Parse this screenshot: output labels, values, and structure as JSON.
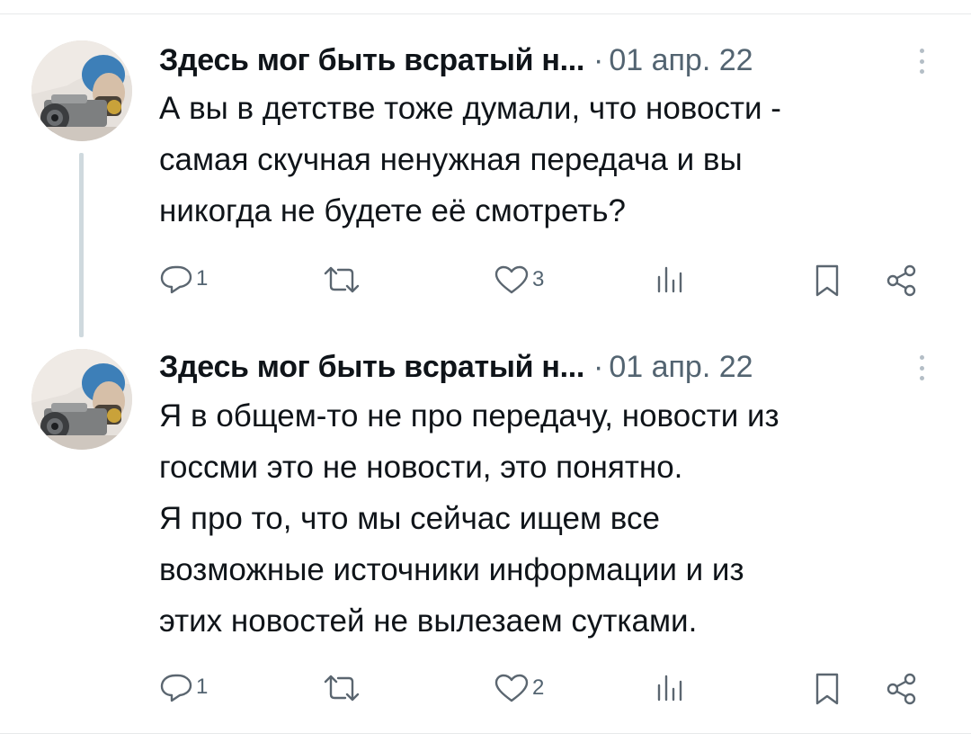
{
  "tweets": [
    {
      "author": "Здесь мог быть вcратый н...",
      "separator": "·",
      "date": "01 апр. 22",
      "lines": [
        "А вы в детстве тоже думали, что новости -",
        "самая скучная ненужная передача и вы",
        "никогда не будете её смотреть?"
      ],
      "actions": {
        "replies": "1",
        "retweets": "",
        "likes": "3"
      },
      "icons": [
        "avatar-image",
        "more-icon",
        "reply-icon",
        "retweet-icon",
        "like-icon",
        "views-icon",
        "bookmark-icon",
        "share-icon"
      ]
    },
    {
      "author": "Здесь мог быть вcратый н...",
      "separator": "·",
      "date": "01 апр. 22",
      "lines": [
        "Я в общем-то не про передачу, новости из",
        "госсми это не новости, это понятно.",
        "Я про то, что мы сейчас ищем все",
        "возможные источники информации и из",
        "этих новостей не вылезаем сутками."
      ],
      "actions": {
        "replies": "1",
        "retweets": "",
        "likes": "2"
      },
      "icons": [
        "avatar-image",
        "more-icon",
        "reply-icon",
        "retweet-icon",
        "like-icon",
        "views-icon",
        "bookmark-icon",
        "share-icon"
      ]
    }
  ],
  "colors": {
    "text": "#0f1419",
    "secondary": "#536471",
    "divider": "#e7e9ea",
    "thread_line": "#cfd9de",
    "icon_gray": "#5b6670"
  }
}
